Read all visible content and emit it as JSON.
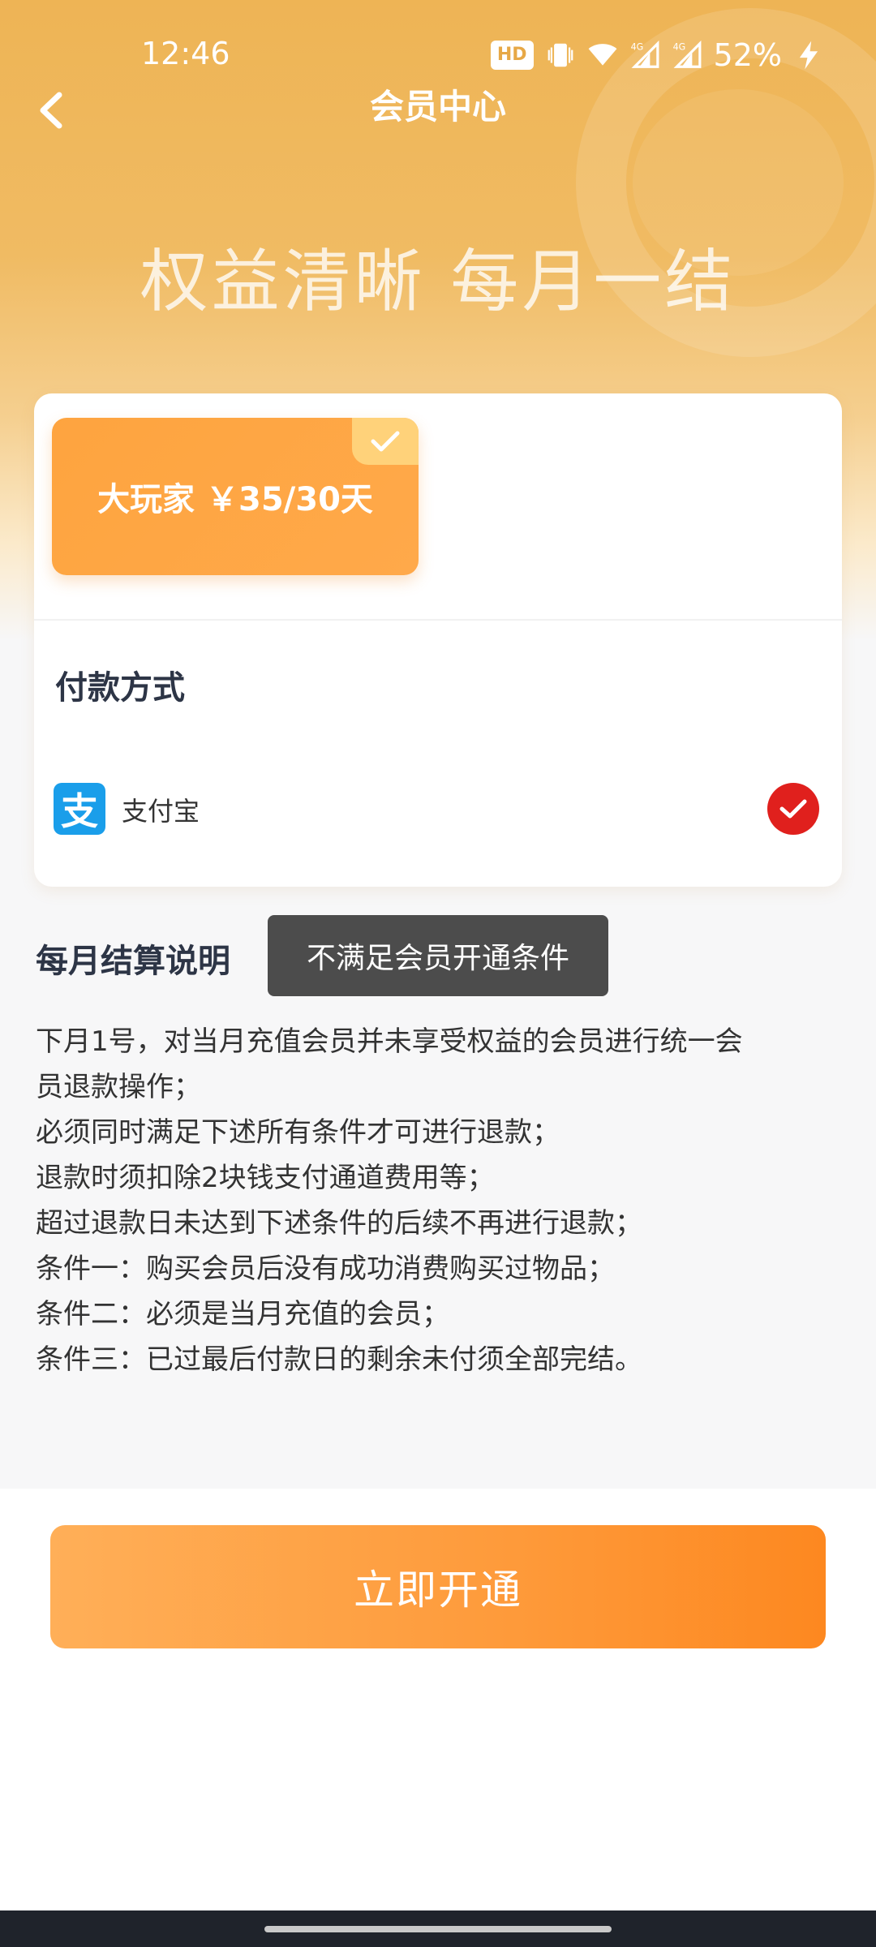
{
  "status_bar": {
    "time": "12:46",
    "hd": "HD",
    "network_1": "4G",
    "network_2": "4G",
    "battery": "52%"
  },
  "header": {
    "title": "会员中心",
    "back_icon": "chevron-left-icon"
  },
  "hero": {
    "slogan": "权益清晰 每月一结"
  },
  "plans": [
    {
      "label": "大玩家 ￥35/30天",
      "selected": true
    }
  ],
  "payment": {
    "title": "付款方式",
    "methods": [
      {
        "name": "支付宝",
        "icon": "alipay-icon",
        "icon_glyph": "支",
        "selected": true
      }
    ]
  },
  "settlement": {
    "title": "每月结算说明",
    "lines": [
      "下月1号，对当月充值会员并未享受权益的会员进行统一会",
      "员退款操作；",
      "必须同时满足下述所有条件才可进行退款；",
      "退款时须扣除2块钱支付通道费用等；",
      "超过退款日未达到下述条件的后续不再进行退款；",
      "条件一：购买会员后没有成功消费购买过物品；",
      "条件二：必须是当月充值的会员；",
      "条件三：已过最后付款日的剩余未付须全部完结。"
    ]
  },
  "toast": {
    "text": "不满足会员开通条件"
  },
  "cta": {
    "label": "立即开通"
  },
  "colors": {
    "accent": "#fe9a3a",
    "hero": "#eeb455",
    "alipay": "#1a9eea",
    "selected_radio": "#e0201d"
  }
}
